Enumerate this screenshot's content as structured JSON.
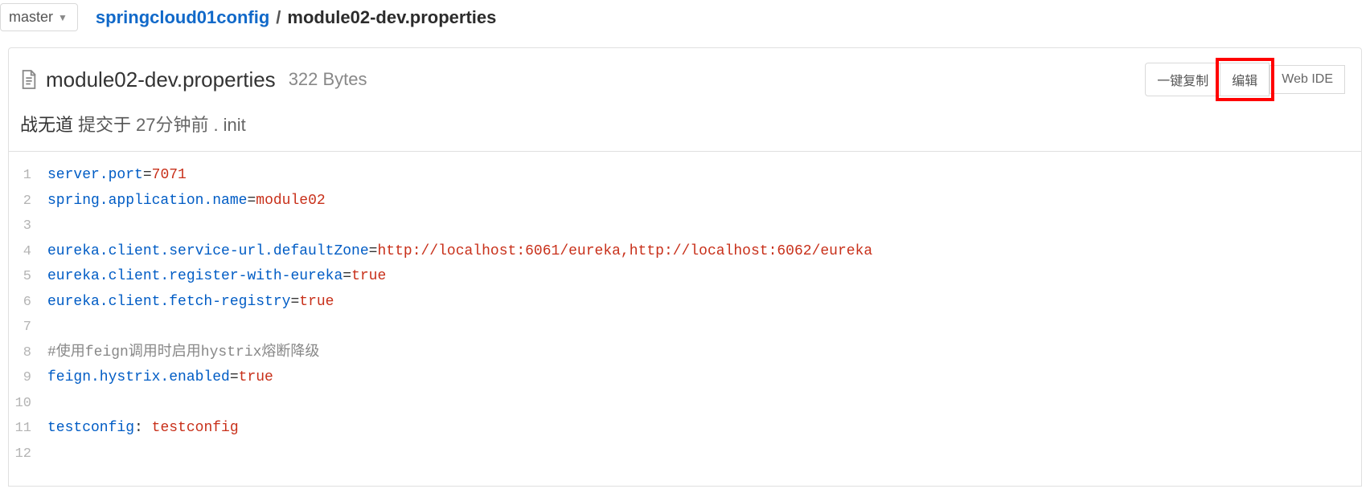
{
  "branch": "master",
  "breadcrumb": {
    "repo": "springcloud01config",
    "separator": "/",
    "file": "module02-dev.properties"
  },
  "file": {
    "icon_name": "file",
    "title": "module02-dev.properties",
    "size": "322 Bytes"
  },
  "actions": {
    "copy": "一键复制",
    "edit": "编辑",
    "webide": "Web IDE"
  },
  "commit": {
    "author": "战无道",
    "committed_label": "提交于",
    "time": "27分钟前",
    "dot": ".",
    "message": "init"
  },
  "code": {
    "lines": [
      {
        "n": "1",
        "tokens": [
          [
            "key",
            "server.port"
          ],
          [
            "eq",
            "="
          ],
          [
            "num",
            "7071"
          ]
        ]
      },
      {
        "n": "2",
        "tokens": [
          [
            "key",
            "spring.application.name"
          ],
          [
            "eq",
            "="
          ],
          [
            "str",
            "module02"
          ]
        ]
      },
      {
        "n": "3",
        "tokens": []
      },
      {
        "n": "4",
        "tokens": [
          [
            "key",
            "eureka.client.service-url.defaultZone"
          ],
          [
            "eq",
            "="
          ],
          [
            "str",
            "http://localhost:6061/eureka,http://localhost:6062/eureka"
          ]
        ]
      },
      {
        "n": "5",
        "tokens": [
          [
            "key",
            "eureka.client.register-with-eureka"
          ],
          [
            "eq",
            "="
          ],
          [
            "bool",
            "true"
          ]
        ]
      },
      {
        "n": "6",
        "tokens": [
          [
            "key",
            "eureka.client.fetch-registry"
          ],
          [
            "eq",
            "="
          ],
          [
            "bool",
            "true"
          ]
        ]
      },
      {
        "n": "7",
        "tokens": []
      },
      {
        "n": "8",
        "tokens": [
          [
            "comment",
            "#使用feign调用时启用hystrix熔断降级"
          ]
        ]
      },
      {
        "n": "9",
        "tokens": [
          [
            "key",
            "feign.hystrix.enabled"
          ],
          [
            "eq",
            "="
          ],
          [
            "bool",
            "true"
          ]
        ]
      },
      {
        "n": "10",
        "tokens": []
      },
      {
        "n": "11",
        "tokens": [
          [
            "key",
            "testconfig"
          ],
          [
            "eq",
            ": "
          ],
          [
            "str",
            "testconfig"
          ]
        ]
      },
      {
        "n": "12",
        "tokens": []
      }
    ]
  }
}
